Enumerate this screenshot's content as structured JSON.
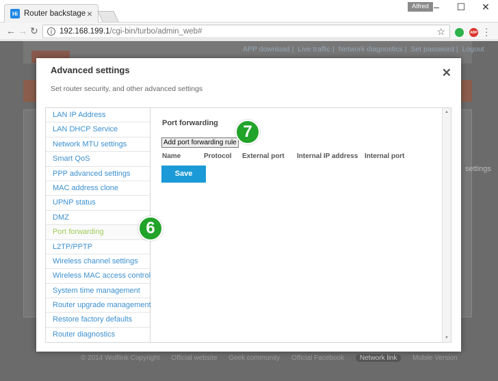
{
  "browser": {
    "tab_title": "Router backstage",
    "tab_favicon": "Hi",
    "profile_name": "Alfred",
    "url_host": "192.168.199.1",
    "url_path": "/cgi-bin/turbo/admin_web#",
    "ext_adblock": "ABP"
  },
  "background_page": {
    "nav": [
      "APP download",
      "Live traffic",
      "Network diagnostics",
      "Set password",
      "Logout"
    ],
    "right_text": "settings",
    "footer": [
      "© 2014 Wolflink Copyright",
      "Official website",
      "Geek community",
      "Official Facebook",
      "Network link",
      "Mobile Version"
    ]
  },
  "modal": {
    "title": "Advanced settings",
    "subtitle": "Set router security, and other advanced settings",
    "menu": [
      "LAN IP Address",
      "LAN DHCP Service",
      "Network MTU settings",
      "Smart QoS",
      "PPP advanced settings",
      "MAC address clone",
      "UPNP status",
      "DMZ",
      "Port forwarding",
      "L2TP/PPTP",
      "Wireless channel settings",
      "Wireless MAC access control",
      "System time management",
      "Router upgrade management",
      "Restore factory defaults",
      "Router diagnostics"
    ],
    "active_index": 8,
    "content": {
      "section_title": "Port forwarding",
      "add_rule_label": "Add port forwarding rule",
      "columns": [
        "Name",
        "Protocol",
        "External port",
        "Internal IP address",
        "Internal port"
      ],
      "save_label": "Save"
    }
  },
  "annotations": {
    "step_a": "6",
    "step_b": "7"
  },
  "colors": {
    "link_blue": "#3a8fd0",
    "active_green": "#9fcc5a",
    "save_blue": "#1a9ad6",
    "badge_green": "#22a32a"
  }
}
